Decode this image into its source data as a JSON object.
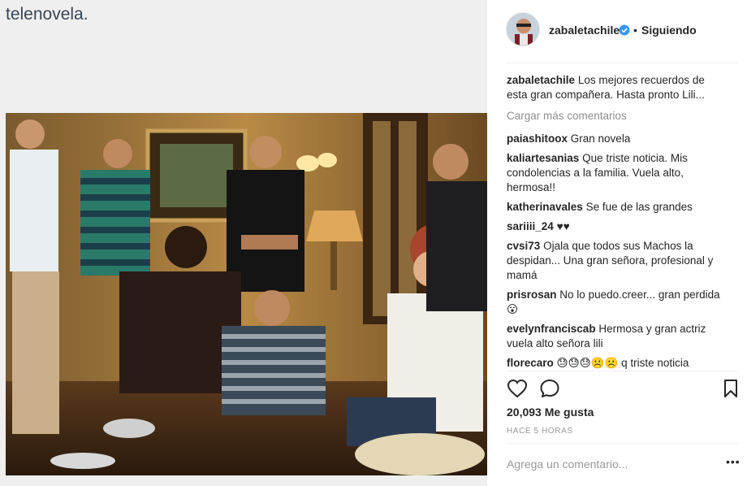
{
  "post": {
    "caption_overlay": "telenovela."
  },
  "header": {
    "username": "zabaletachile",
    "separator": "•",
    "follow_status": "Siguiendo"
  },
  "caption": {
    "username": "zabaletachile",
    "text": "Los mejores recuerdos de esta gran compañera. Hasta pronto Lili..."
  },
  "load_more_label": "Cargar más comentarios",
  "comments": [
    {
      "user": "paiashitoox",
      "text": "Gran novela"
    },
    {
      "user": "kaliartesanias",
      "text": "Que triste noticia. Mis condolencias a la familia. Vuela alto, hermosa!!"
    },
    {
      "user": "katherinavales",
      "text": "Se fue de las grandes"
    },
    {
      "user": "sariiii_24",
      "text": "♥♥"
    },
    {
      "user": "cvsi73",
      "text": "Ojala que todos sus Machos la despidan... Una gran señora, profesional y mamá"
    },
    {
      "user": "prisrosan",
      "text": "No lo puedo.creer... gran perdida 😮"
    },
    {
      "user": "evelynfranciscab",
      "text": "Hermosa y gran actriz vuela alto señora lili"
    },
    {
      "user": "florecaro",
      "text": "😓😓😓☹️☹️ q triste noticia"
    }
  ],
  "likes_text": "20,093 Me gusta",
  "time_text": "HACE 5 HORAS",
  "add_comment_placeholder": "Agrega un comentario...",
  "more_label": "•••",
  "icons": {
    "like": "heart-icon",
    "comment": "comment-icon",
    "save": "bookmark-icon",
    "verified": "verified-badge-icon"
  },
  "colors": {
    "verified": "#3897f0",
    "muted": "#8e8e8e",
    "text": "#262626"
  }
}
